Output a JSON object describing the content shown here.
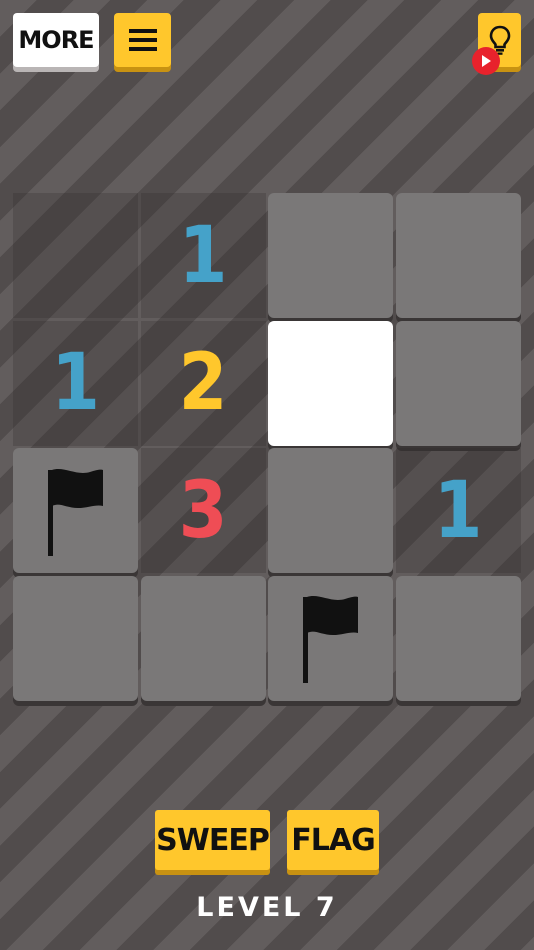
{
  "header": {
    "more_label": "MORE",
    "menu_icon": "hamburger-menu-icon",
    "hint_icon": "lightbulb-icon",
    "video_icon": "play-video-icon"
  },
  "colors": {
    "one": "#45a2c9",
    "two": "#ffc72c",
    "three": "#ef4d55",
    "accent": "#ffc72c"
  },
  "board": {
    "rows": 4,
    "cols": 4,
    "cells": [
      {
        "row": 0,
        "col": 0,
        "state": "revealed",
        "value": ""
      },
      {
        "row": 0,
        "col": 1,
        "state": "revealed",
        "value": "1"
      },
      {
        "row": 0,
        "col": 2,
        "state": "hidden",
        "value": ""
      },
      {
        "row": 0,
        "col": 3,
        "state": "hidden",
        "value": ""
      },
      {
        "row": 1,
        "col": 0,
        "state": "revealed",
        "value": "1"
      },
      {
        "row": 1,
        "col": 1,
        "state": "revealed",
        "value": "2"
      },
      {
        "row": 1,
        "col": 2,
        "state": "selected",
        "value": ""
      },
      {
        "row": 1,
        "col": 3,
        "state": "hidden",
        "value": ""
      },
      {
        "row": 2,
        "col": 0,
        "state": "flagged",
        "value": ""
      },
      {
        "row": 2,
        "col": 1,
        "state": "revealed",
        "value": "3"
      },
      {
        "row": 2,
        "col": 2,
        "state": "hidden",
        "value": ""
      },
      {
        "row": 2,
        "col": 3,
        "state": "revealed",
        "value": "1"
      },
      {
        "row": 3,
        "col": 0,
        "state": "hidden",
        "value": ""
      },
      {
        "row": 3,
        "col": 1,
        "state": "hidden",
        "value": ""
      },
      {
        "row": 3,
        "col": 2,
        "state": "flagged",
        "value": ""
      },
      {
        "row": 3,
        "col": 3,
        "state": "hidden",
        "value": ""
      }
    ]
  },
  "controls": {
    "sweep_label": "SWEEP",
    "flag_label": "FLAG"
  },
  "level": {
    "prefix": "LEVEL",
    "number": "7"
  }
}
